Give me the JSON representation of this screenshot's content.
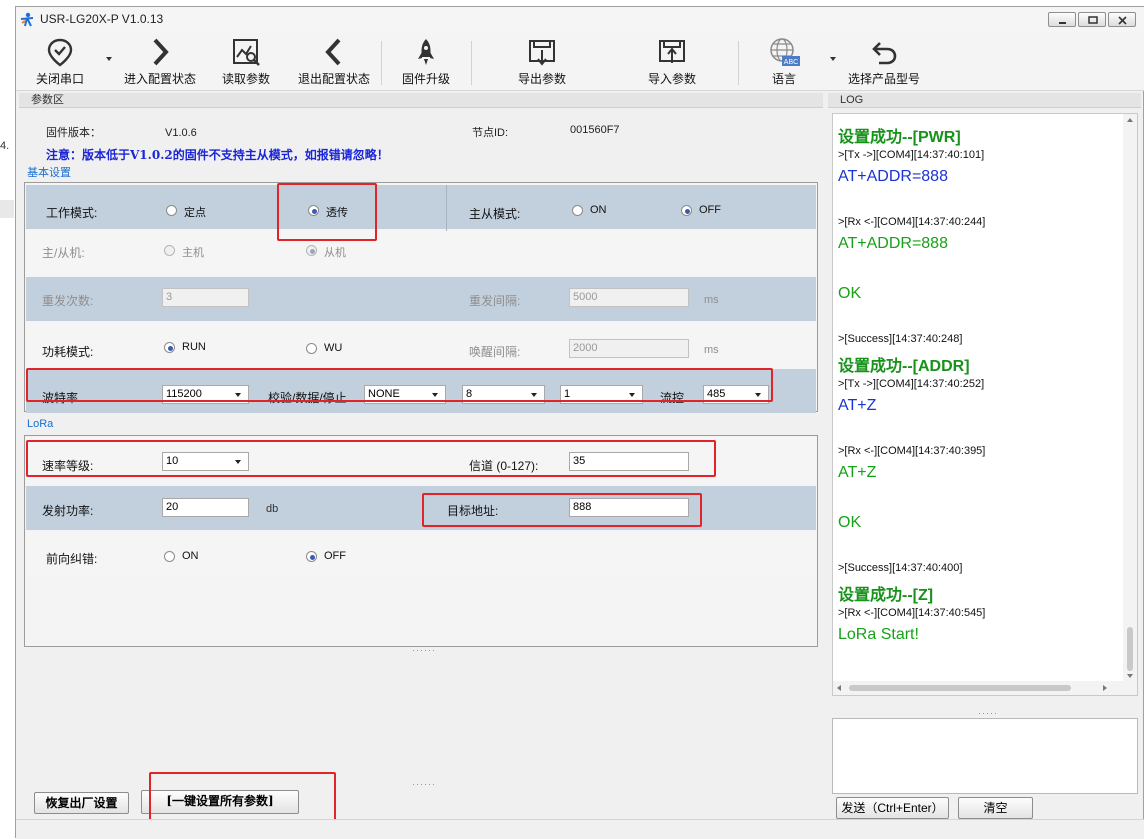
{
  "window": {
    "title": "USR-LG20X-P  V1.0.13"
  },
  "toolbar": {
    "close_port": "关闭串口",
    "enter_config": "进入配置状态",
    "read_params": "读取参数",
    "exit_config": "退出配置状态",
    "firmware_upgrade": "固件升级",
    "export_params": "导出参数",
    "import_params": "导入参数",
    "language": "语言",
    "language_badge": "ABC",
    "select_model": "选择产品型号"
  },
  "params": {
    "panel_title": "参数区",
    "firmware_label": "固件版本：",
    "firmware_value": "V1.0.6",
    "node_id_label": "节点ID:",
    "node_id_value": "001560F7",
    "notice": "注意：版本低于V1.0.2的固件不支持主从模式，如报错请忽略！",
    "basic_title": "基本设置",
    "work_mode_label": "工作模式:",
    "work_mode_opt1": "定点",
    "work_mode_opt2": "透传",
    "master_slave_mode_label": "主从模式:",
    "master_slave_on": "ON",
    "master_slave_off": "OFF",
    "role_label": "主/从机:",
    "role_master": "主机",
    "role_slave": "从机",
    "retry_label": "重发次数:",
    "retry_value": "3",
    "retry_interval_label": "重发间隔:",
    "retry_interval_value": "5000",
    "retry_interval_unit": "ms",
    "power_mode_label": "功耗模式:",
    "power_run": "RUN",
    "power_wu": "WU",
    "wake_interval_label": "唤醒间隔:",
    "wake_interval_value": "2000",
    "wake_interval_unit": "ms",
    "baud_label": "波特率",
    "baud_value": "115200",
    "parity_label": "校验/数据/停止",
    "parity_value": "NONE",
    "data_bits_value": "8",
    "stop_bits_value": "1",
    "flow_label": "流控",
    "flow_value": "485",
    "lora_title": "LoRa",
    "rate_label": "速率等级:",
    "rate_value": "10",
    "channel_label": "信道 (0-127):",
    "channel_value": "35",
    "tx_power_label": "发射功率:",
    "tx_power_value": "20",
    "tx_power_unit": "db",
    "target_addr_label": "目标地址:",
    "target_addr_value": "888",
    "fec_label": "前向纠错:",
    "fec_on": "ON",
    "fec_off": "OFF",
    "restore_button": "恢复出厂设置",
    "set_all_button": "[一键设置所有参数]"
  },
  "log": {
    "title": "LOG",
    "send_button": "发送（Ctrl+Enter）",
    "clear_button": "清空",
    "entries": [
      {
        "text": "设置成功--[PWR]"
      },
      {
        "text": ">[Tx ->][COM4][14:37:40:101]"
      },
      {
        "text": "AT+ADDR=888"
      },
      {
        "text": ">[Rx <-][COM4][14:37:40:244]"
      },
      {
        "text": "AT+ADDR=888"
      },
      {
        "text": "OK"
      },
      {
        "text": ">[Success][14:37:40:248]"
      },
      {
        "text": "设置成功--[ADDR]"
      },
      {
        "text": ">[Tx ->][COM4][14:37:40:252]"
      },
      {
        "text": "AT+Z"
      },
      {
        "text": ">[Rx <-][COM4][14:37:40:395]"
      },
      {
        "text": "AT+Z"
      },
      {
        "text": "OK"
      },
      {
        "text": ">[Success][14:37:40:400]"
      },
      {
        "text": "设置成功--[Z]"
      },
      {
        "text": ">[Rx <-][COM4][14:37:40:545]"
      },
      {
        "text": "LoRa Start!"
      }
    ]
  },
  "colors": {
    "accent_blue": "#1a33d4",
    "success_green": "#16a216",
    "highlight_red": "#e0242a",
    "row_blue": "#c2d0de"
  }
}
